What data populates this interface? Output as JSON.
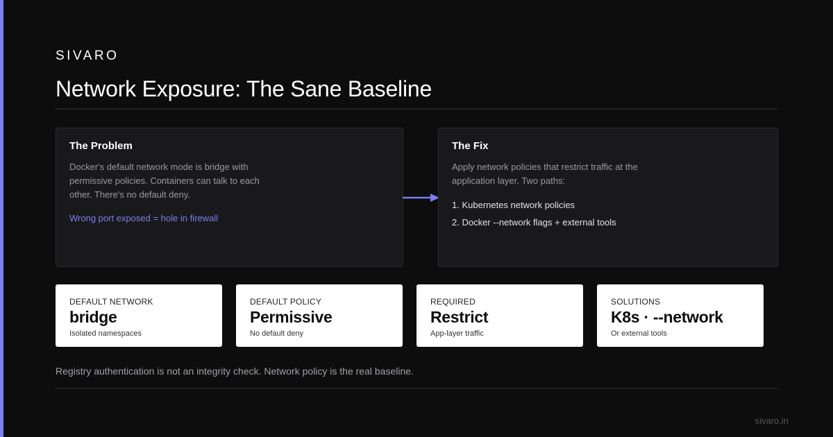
{
  "brand": "SIVARO",
  "title": "Network Exposure: The Sane Baseline",
  "colors": {
    "accent": "#7b7ff0",
    "background": "#0d0d0e",
    "panel": "#19191b"
  },
  "problem": {
    "title": "The Problem",
    "body": "Docker's default network mode is bridge with permissive policies. Containers can talk to each other. There's no default deny.",
    "note": "Wrong port exposed = hole in firewall"
  },
  "arrow_icon": "arrow-right-icon",
  "fix": {
    "title": "The Fix",
    "body": "Apply network policies that restrict traffic at the application layer. Two paths:",
    "items": [
      "1. Kubernetes network policies",
      "2. Docker --network flags + external tools"
    ]
  },
  "stats": [
    {
      "label": "DEFAULT NETWORK",
      "value": "bridge",
      "sub": "Isolated namespaces"
    },
    {
      "label": "DEFAULT POLICY",
      "value": "Permissive",
      "sub": "No default deny"
    },
    {
      "label": "REQUIRED",
      "value": "Restrict",
      "sub": "App-layer traffic"
    },
    {
      "label": "SOLUTIONS",
      "value": "K8s · --network",
      "sub": "Or external tools"
    }
  ],
  "footer_note": "Registry authentication is not an integrity check. Network policy is the real baseline.",
  "site": "sivaro.in"
}
